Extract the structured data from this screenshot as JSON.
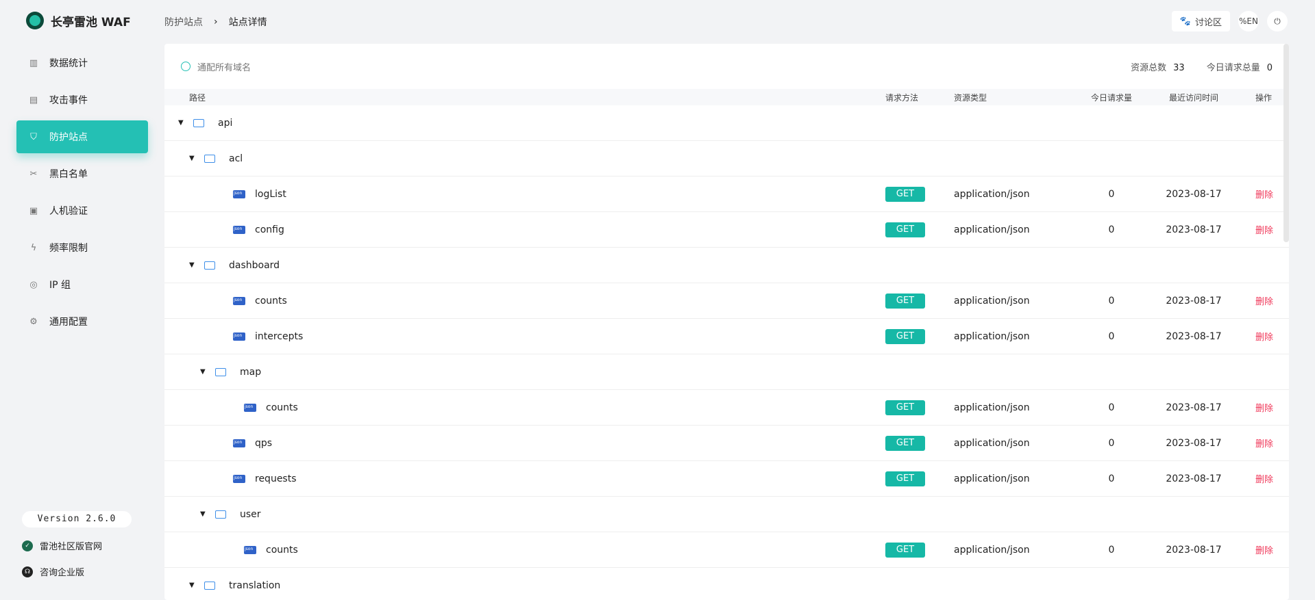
{
  "app": {
    "title": "长亭雷池 WAF"
  },
  "nav": [
    {
      "label": "数据统计",
      "icon": "bar-chart-icon"
    },
    {
      "label": "攻击事件",
      "icon": "document-icon"
    },
    {
      "label": "防护站点",
      "icon": "shield-icon",
      "active": true
    },
    {
      "label": "黑白名单",
      "icon": "tools-icon"
    },
    {
      "label": "人机验证",
      "icon": "id-card-icon"
    },
    {
      "label": "频率限制",
      "icon": "bolt-icon"
    },
    {
      "label": "IP 组",
      "icon": "location-icon"
    },
    {
      "label": "通用配置",
      "icon": "gear-icon"
    }
  ],
  "version": "Version 2.6.0",
  "footer": {
    "community": "雷池社区版官网",
    "enterprise": "咨询企业版"
  },
  "breadcrumb": {
    "parent": "防护站点",
    "sep": "›",
    "current": "站点详情"
  },
  "top": {
    "forum": "讨论区",
    "lang": "%EN",
    "logout_icon": "logout-icon"
  },
  "panel": {
    "domain_placeholder": "通配所有域名",
    "total_label": "资源总数",
    "total_value": "33",
    "today_label": "今日请求总量",
    "today_value": "0"
  },
  "columns": {
    "path": "路径",
    "method": "请求方法",
    "type": "资源类型",
    "count": "今日请求量",
    "time": "最近访问时间",
    "op": "操作"
  },
  "rows": [
    {
      "kind": "folder",
      "level": 0,
      "name": "api"
    },
    {
      "kind": "folder",
      "level": 1,
      "name": "acl"
    },
    {
      "kind": "file",
      "level": 2,
      "name": "logList",
      "method": "GET",
      "type": "application/json",
      "count": "0",
      "time": "2023-08-17",
      "op": "删除"
    },
    {
      "kind": "file",
      "level": 2,
      "name": "config",
      "method": "GET",
      "type": "application/json",
      "count": "0",
      "time": "2023-08-17",
      "op": "删除"
    },
    {
      "kind": "folder",
      "level": 1,
      "name": "dashboard"
    },
    {
      "kind": "file",
      "level": 2,
      "name": "counts",
      "method": "GET",
      "type": "application/json",
      "count": "0",
      "time": "2023-08-17",
      "op": "删除"
    },
    {
      "kind": "file",
      "level": 2,
      "name": "intercepts",
      "method": "GET",
      "type": "application/json",
      "count": "0",
      "time": "2023-08-17",
      "op": "删除"
    },
    {
      "kind": "folder",
      "level": 2,
      "name": "map"
    },
    {
      "kind": "file",
      "level": 3,
      "name": "counts",
      "method": "GET",
      "type": "application/json",
      "count": "0",
      "time": "2023-08-17",
      "op": "删除"
    },
    {
      "kind": "file",
      "level": 2,
      "name": "qps",
      "method": "GET",
      "type": "application/json",
      "count": "0",
      "time": "2023-08-17",
      "op": "删除"
    },
    {
      "kind": "file",
      "level": 2,
      "name": "requests",
      "method": "GET",
      "type": "application/json",
      "count": "0",
      "time": "2023-08-17",
      "op": "删除"
    },
    {
      "kind": "folder",
      "level": 2,
      "name": "user"
    },
    {
      "kind": "file",
      "level": 3,
      "name": "counts",
      "method": "GET",
      "type": "application/json",
      "count": "0",
      "time": "2023-08-17",
      "op": "删除"
    },
    {
      "kind": "folder",
      "level": 1,
      "name": "translation"
    }
  ]
}
